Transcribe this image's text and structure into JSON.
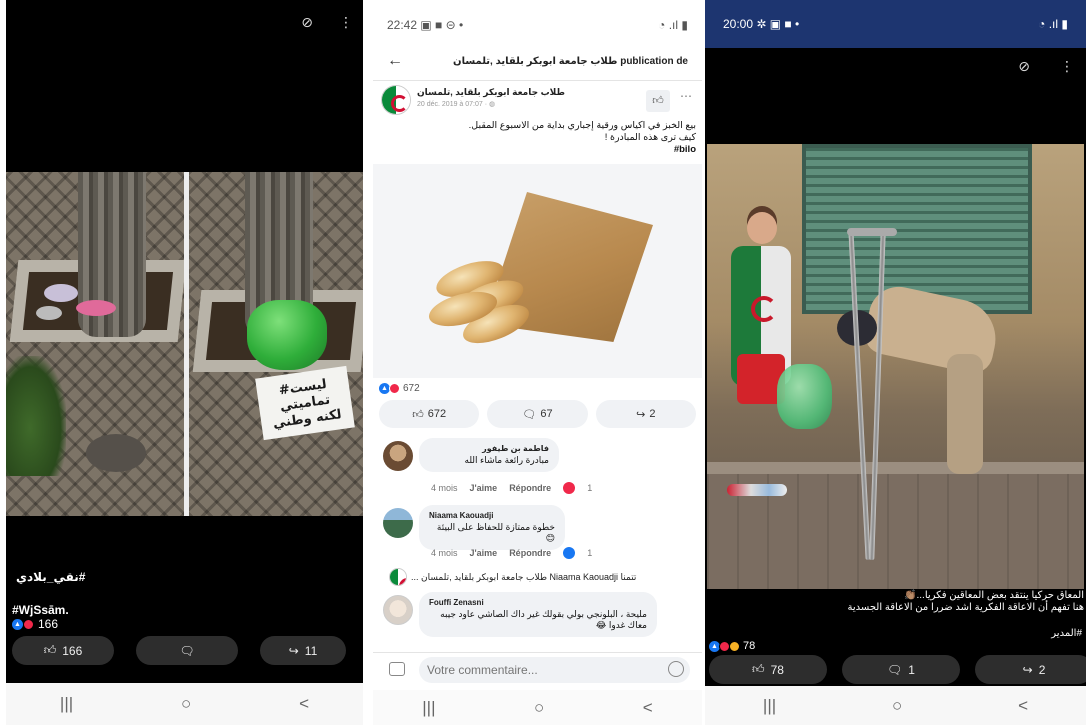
{
  "panel1": {
    "caption_hashtag": "نقي_بلادي#",
    "caption_tag": "#WjSsām.",
    "reaction_count": "166",
    "sign_text_line1": "#ليست تماميتي",
    "sign_text_line2": "لكنه وطني",
    "buttons": {
      "like_count": "166",
      "share_count": "11"
    },
    "nav": {
      "recents": "|||",
      "home": "○",
      "back": "<"
    }
  },
  "panel2": {
    "status_time": "22:42",
    "status_icons_left": "▣ ■ ⊝ •",
    "status_icons_right": "◔ .ıl ▮",
    "header_title": "طلاب جامعة ابوبكر بلقايد ,تلمسان publication de",
    "author_name": "طلاب جامعة ابوبكر بلقايد ,تلمسان",
    "author_time": "20 déc. 2019 à 07:07 · ◍",
    "post_line1": "بيع الخبز في اكياس ورقية إجباري بداية من الاسبوع المقبل.",
    "post_line2": "كيف ترى هذه المبادرة !",
    "post_line3": "bilo#",
    "reaction_total": "672",
    "actions": {
      "like": "672",
      "comment": "67",
      "share": "2"
    },
    "comments": [
      {
        "name": "فاطمة بن طيفور",
        "text": "مبادرة رائعة ماشاء الله",
        "time": "4 mois",
        "like": "J'aime",
        "reply": "Répondre",
        "count": "1"
      },
      {
        "name": "Niaama Kaouadji",
        "text": "خطوة ممتازة للحفاظ على البيئة 😊",
        "time": "4 mois",
        "like": "J'aime",
        "reply": "Répondre",
        "count": "1"
      },
      {
        "name": "Fouffi Zenasni",
        "text": "مليحة ، البلونجي بولي بقولك غير داك الصاشي عاود جيبه معاك غدوا 😂"
      }
    ],
    "shared_line": "تتمنا Niaama Kaouadji طلاب جامعة ابوبكر بلقايد ,تلمسان ...",
    "composer_placeholder": "Votre commentaire...",
    "nav": {
      "recents": "|||",
      "home": "○",
      "back": "<"
    }
  },
  "panel3": {
    "status_time": "20:00",
    "status_icons_left": "✲ ▣ ■ •",
    "status_icons_right": "◔ .ıl ▮",
    "overlay_line1": "المعاق حركيا ينتقد بعض المعاقين فكريا...👏🏽",
    "overlay_line2": "هنا تفهم أن الاعاقة الفكرية اشد ضررا من الاعاقة الجسدية",
    "overlay_tag": "#المدير",
    "reaction_count": "78",
    "buttons": {
      "like": "78",
      "comment": "1",
      "share": "2"
    },
    "nav": {
      "recents": "|||",
      "home": "○",
      "back": "<"
    }
  }
}
